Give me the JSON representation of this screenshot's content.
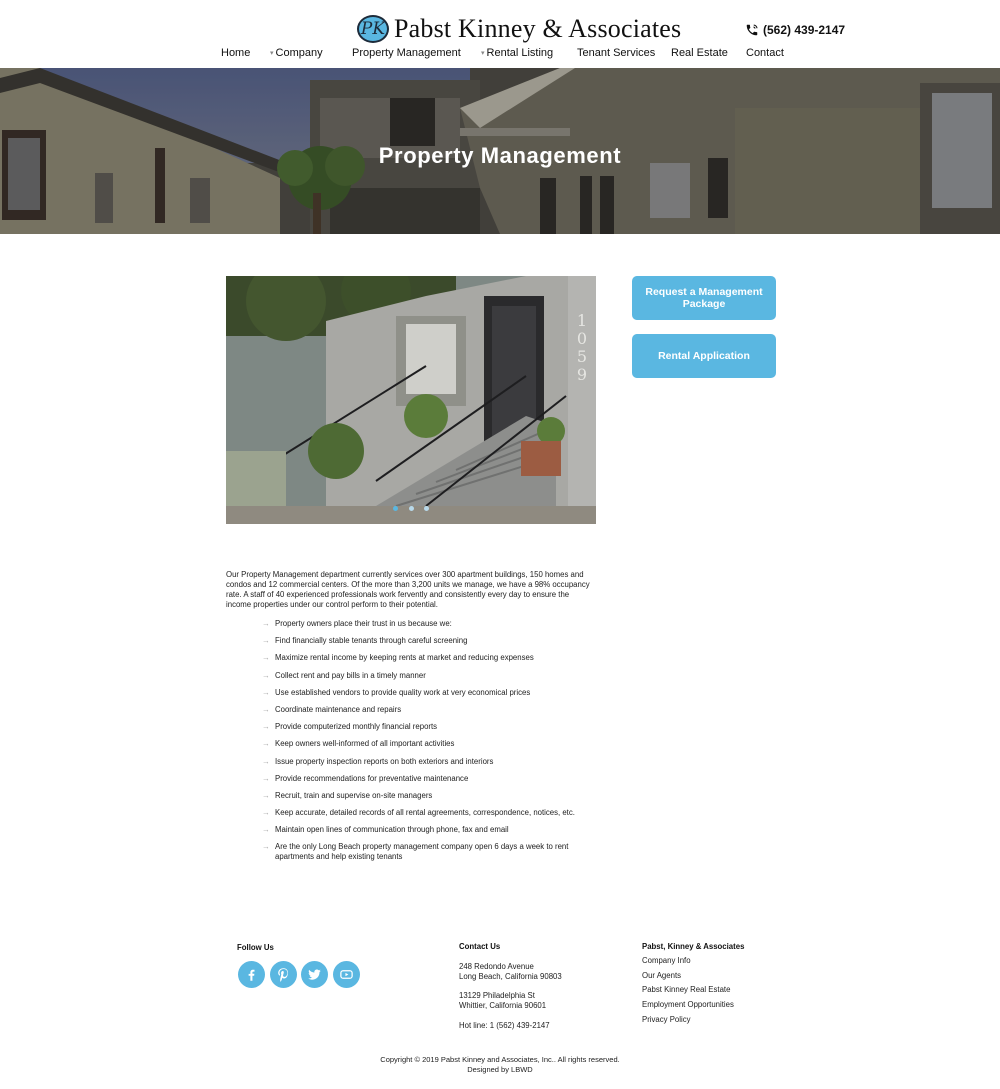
{
  "header": {
    "logo_mark": "PK",
    "brand_name": "Pabst Kinney & Associates",
    "phone": "(562) 439-2147",
    "phone_icon": "phone-icon"
  },
  "nav": {
    "items": [
      {
        "label": "Home",
        "has_dropdown": false
      },
      {
        "label": "Company",
        "has_dropdown": true
      },
      {
        "label": "Property Management",
        "has_dropdown": false
      },
      {
        "label": "Rental Listing",
        "has_dropdown": true
      },
      {
        "label": "Tenant Services",
        "has_dropdown": false
      },
      {
        "label": "Real Estate",
        "has_dropdown": false
      },
      {
        "label": "Contact",
        "has_dropdown": false
      }
    ],
    "dropdown_glyph": "▾"
  },
  "hero": {
    "title": "Property Management"
  },
  "slider": {
    "slide_count": 3,
    "active_slide": 1,
    "building_number": "1059"
  },
  "actions": {
    "request_package": "Request a Management Package",
    "rental_application": "Rental Application"
  },
  "content": {
    "intro": "Our Property Management department currently services over 300 apartment buildings, 150 homes and condos and 12 commercial centers. Of the more than 3,200 units we manage, we have a 98% occupancy rate. A staff of 40 experienced professionals work fervently and consistently every day to ensure the income properties under our control perform to their potential.",
    "bullet_mark": "→",
    "bullets": [
      "Property owners place their trust in us because we:",
      "Find financially stable tenants through careful screening",
      "Maximize rental income by keeping rents at market and reducing expenses",
      "Collect rent and pay bills in a timely manner",
      "Use established vendors to provide quality work at very economical prices",
      "Coordinate maintenance and repairs",
      "Provide computerized monthly financial reports",
      "Keep owners well-informed of all important activities",
      "Issue property inspection reports on both exteriors and interiors",
      "Provide recommendations for preventative maintenance",
      "Recruit, train and supervise on-site managers",
      "Keep accurate, detailed records of all rental agreements, correspondence, notices, etc.",
      "Maintain open lines of communication through phone, fax and email",
      "Are the only Long Beach property management company open 6 days a week to rent apartments and help existing tenants"
    ]
  },
  "footer": {
    "follow_heading": "Follow Us",
    "socials": [
      "facebook-icon",
      "pinterest-icon",
      "twitter-icon",
      "youtube-icon"
    ],
    "contact_heading": "Contact Us",
    "address1_line1": "248 Redondo Avenue",
    "address1_line2": "Long Beach, California 90803",
    "address2_line1": "13129 Philadelphia St",
    "address2_line2": "Whittier, California 90601",
    "hotline": "Hot line: 1 (562) 439-2147",
    "company_heading": "Pabst, Kinney & Associates",
    "company_links": [
      "Company Info",
      "Our Agents",
      "Pabst Kinney Real Estate",
      "Employment Opportunities",
      "Privacy Policy"
    ],
    "copyright": "Copyright © 2019 Pabst Kinney and Associates, Inc.. All rights reserved.",
    "designed_by": "Designed by LBWD"
  },
  "colors": {
    "accent": "#5ab7e1",
    "text": "#222222"
  }
}
